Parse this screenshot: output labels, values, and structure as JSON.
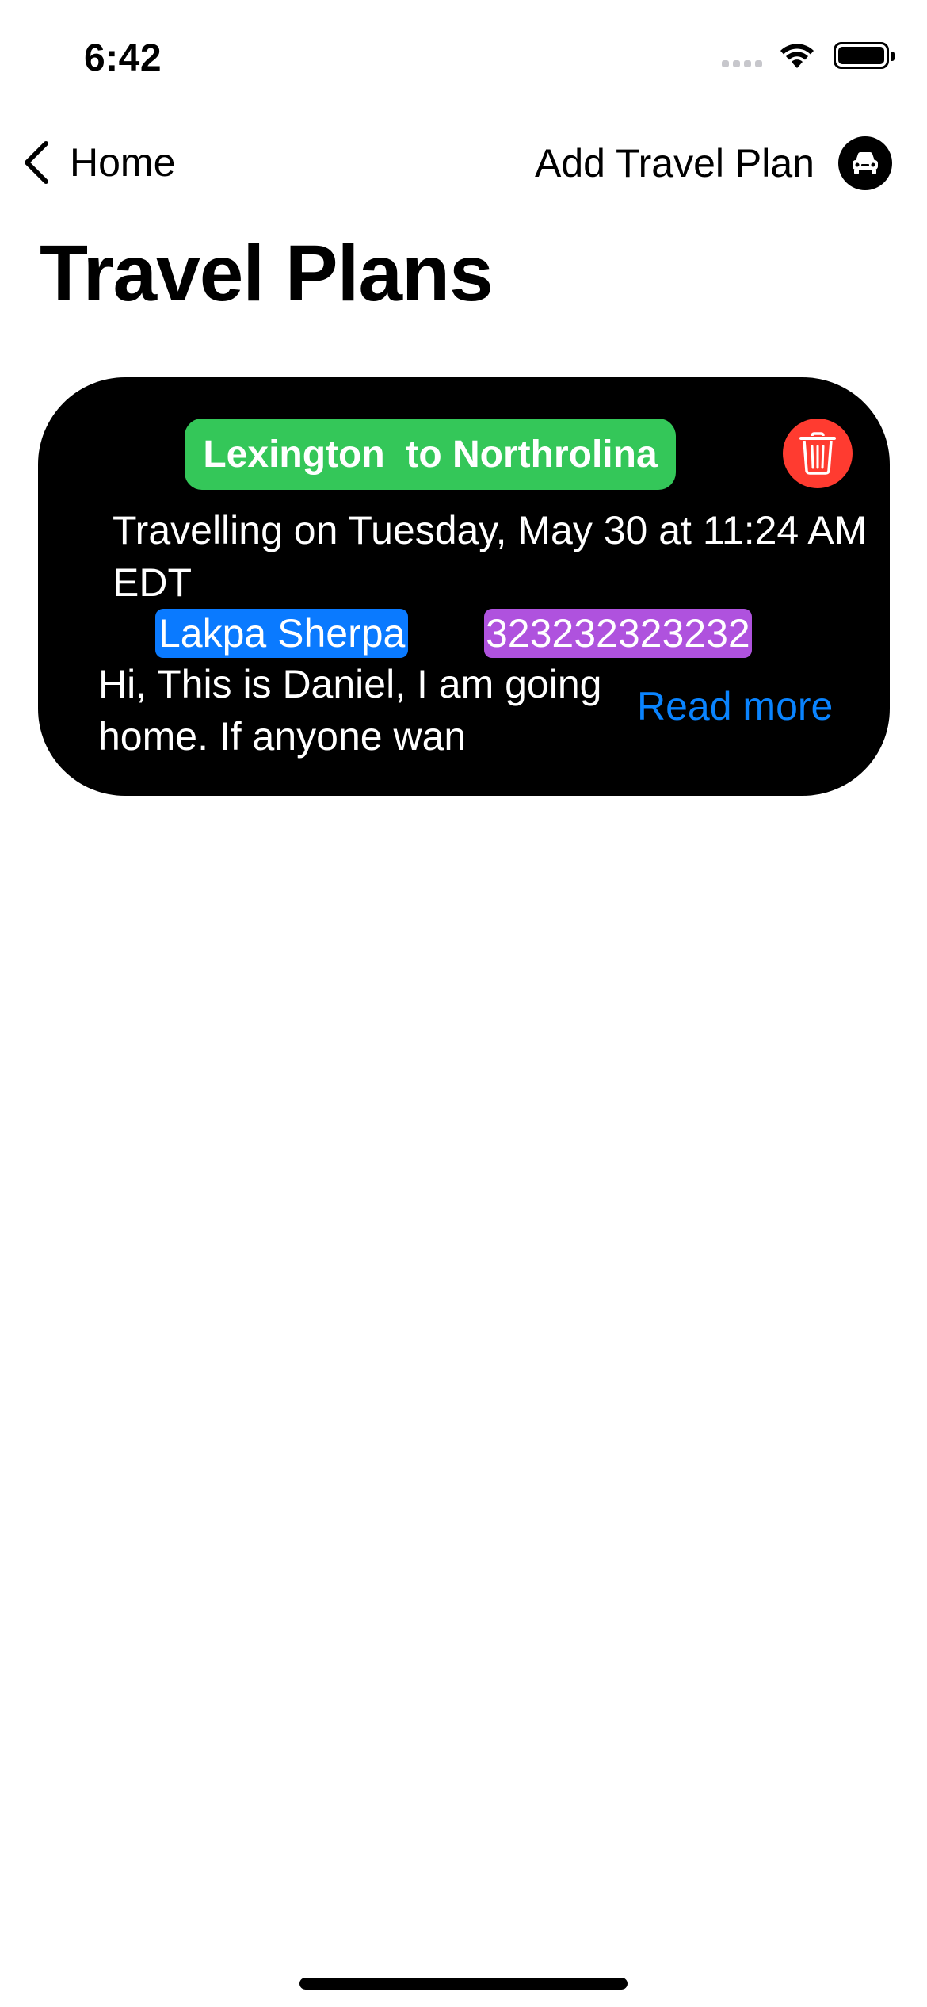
{
  "status_bar": {
    "time": "6:42"
  },
  "nav": {
    "back_label": "Home",
    "add_label": "Add Travel Plan",
    "add_icon": "car-icon"
  },
  "page": {
    "title": "Travel Plans"
  },
  "plans": [
    {
      "route": "Lexington  to Northrolina",
      "travel_date": "Travelling on Tuesday, May 30 at 11:24 AM EDT",
      "name": "Lakpa Sherpa",
      "phone": "323232323232",
      "description": "Hi, This is Daniel, I am going home. If anyone wan",
      "read_more_label": "Read more",
      "delete_icon": "trash-icon"
    }
  ],
  "colors": {
    "route_pill": "#34c759",
    "delete": "#ff3b30",
    "name_tag": "#0a7aff",
    "phone_tag": "#af52de",
    "link": "#0a84ff",
    "card": "#000000"
  }
}
